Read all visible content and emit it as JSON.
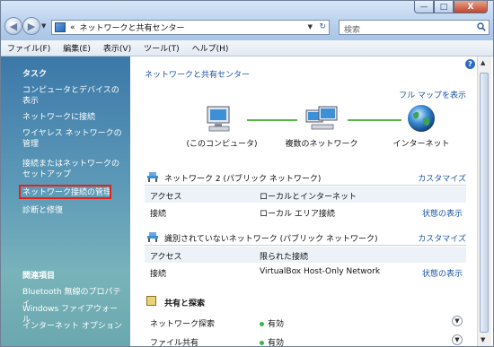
{
  "window": {
    "minimize": "—",
    "maximize": "□",
    "close": "X"
  },
  "address": {
    "prefix": "«",
    "path": "ネットワークと共有センター"
  },
  "search": {
    "placeholder": "検索"
  },
  "menu": [
    "ファイル(F)",
    "編集(E)",
    "表示(V)",
    "ツール(T)",
    "ヘルプ(H)"
  ],
  "tasks": {
    "heading": "タスク",
    "links": [
      "コンピュータとデバイスの表示",
      "ネットワークに接続",
      "ワイヤレス ネットワークの管理",
      "接続またはネットワークのセットアップ",
      "ネットワーク接続の管理",
      "診断と修復"
    ],
    "related_heading": "関連項目",
    "related_links": [
      "Bluetooth 無線のプロパティ",
      "Windows ファイアウォール",
      "インターネット オプション"
    ]
  },
  "main": {
    "help": "?",
    "title": "ネットワークと共有センター",
    "full_map": "フル マップを表示",
    "map": {
      "computer_label": "(このコンピュータ)",
      "middle_label": "複数のネットワーク",
      "internet_label": "インターネット"
    },
    "network1": {
      "title": "ネットワーク  2 (パブリック ネットワーク)",
      "customize": "カスタマイズ",
      "rows": [
        {
          "k": "アクセス",
          "v": "ローカルとインターネット",
          "a": ""
        },
        {
          "k": "接続",
          "v": "ローカル エリア接続",
          "a": "状態の表示"
        }
      ]
    },
    "network2": {
      "title": "識別されていないネットワーク (パブリック ネットワーク)",
      "customize": "カスタマイズ",
      "rows": [
        {
          "k": "アクセス",
          "v": "限られた接続",
          "a": ""
        },
        {
          "k": "接続",
          "v": "VirtualBox Host-Only Network",
          "a": "状態の表示"
        }
      ]
    },
    "sharing": {
      "title": "共有と探索",
      "rows": [
        {
          "k": "ネットワーク探索",
          "v": "有効"
        },
        {
          "k": "ファイル共有",
          "v": "有効"
        }
      ]
    }
  },
  "colors": {
    "link": "#1b54a5",
    "highlight": "#e2231a",
    "connector": "#58b548"
  }
}
